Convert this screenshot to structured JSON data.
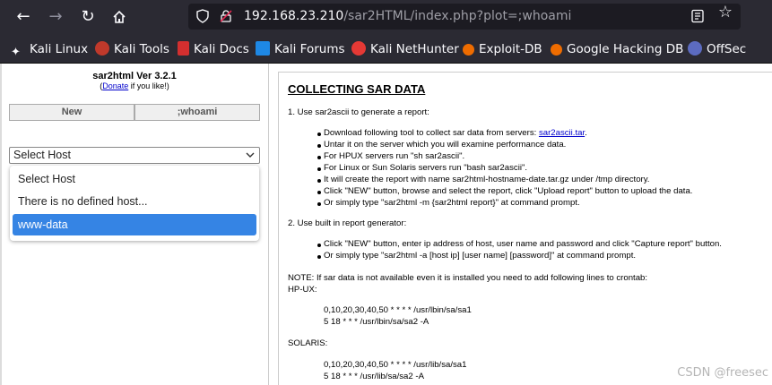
{
  "browser": {
    "url_host": "192.168.23.210",
    "url_path": "/sar2HTML/index.php?plot=;whoami",
    "bookmarks": [
      "Kali Linux",
      "Kali Tools",
      "Kali Docs",
      "Kali Forums",
      "Kali NetHunter",
      "Exploit-DB",
      "Google Hacking DB",
      "OffSec"
    ]
  },
  "left": {
    "title": "sar2html Ver 3.2.1",
    "donate_prefix": "(",
    "donate_link": "Donate",
    "donate_suffix": " if you like!)",
    "new_button": "New",
    "cmd_button": ";whoami",
    "select_value": "Select Host",
    "dropdown_items": [
      "Select Host",
      "There is no defined host...",
      "www-data"
    ]
  },
  "right": {
    "heading": "COLLECTING SAR DATA",
    "step1": "1. Use sar2ascii to generate a report:",
    "b1_text": "Download following tool to collect sar data from servers: ",
    "b1_link": "sar2ascii.tar",
    "b1_end": ".",
    "b2": "Untar it on the server which you will examine performance data.",
    "b3": "For HPUX servers run \"sh sar2ascii\".",
    "b4": "For Linux or Sun Solaris servers run \"bash sar2ascii\".",
    "b5": "It will create the report with name sar2html-hostname-date.tar.gz under /tmp directory.",
    "b6": "Click \"NEW\" button, browse and select the report, click \"Upload report\" button to upload the data.",
    "b7": "Or simply type \"sar2html -m {sar2html report}\" at command prompt.",
    "step2": "2. Use built in report generator:",
    "c1": "Click \"NEW\" button, enter ip address of host, user name and password and click \"Capture report\" button.",
    "c2": "Or simply type \"sar2html -a [host ip] [user name] [password]\" at command prompt.",
    "note": "NOTE: If sar data is not available even it is installed you need to add following lines to crontab:",
    "hpux": "HP-UX:",
    "hp1": "0,10,20,30,40,50 * * * * /usr/lbin/sa/sa1",
    "hp2": "5 18 * * * /usr/lbin/sa/sa2 -A",
    "solaris": "SOLARIS:",
    "so1": "0,10,20,30,40,50 * * * * /usr/lib/sa/sa1",
    "so2": "5 18 * * * /usr/lib/sa/sa2 -A"
  },
  "watermark": "CSDN @freesec"
}
